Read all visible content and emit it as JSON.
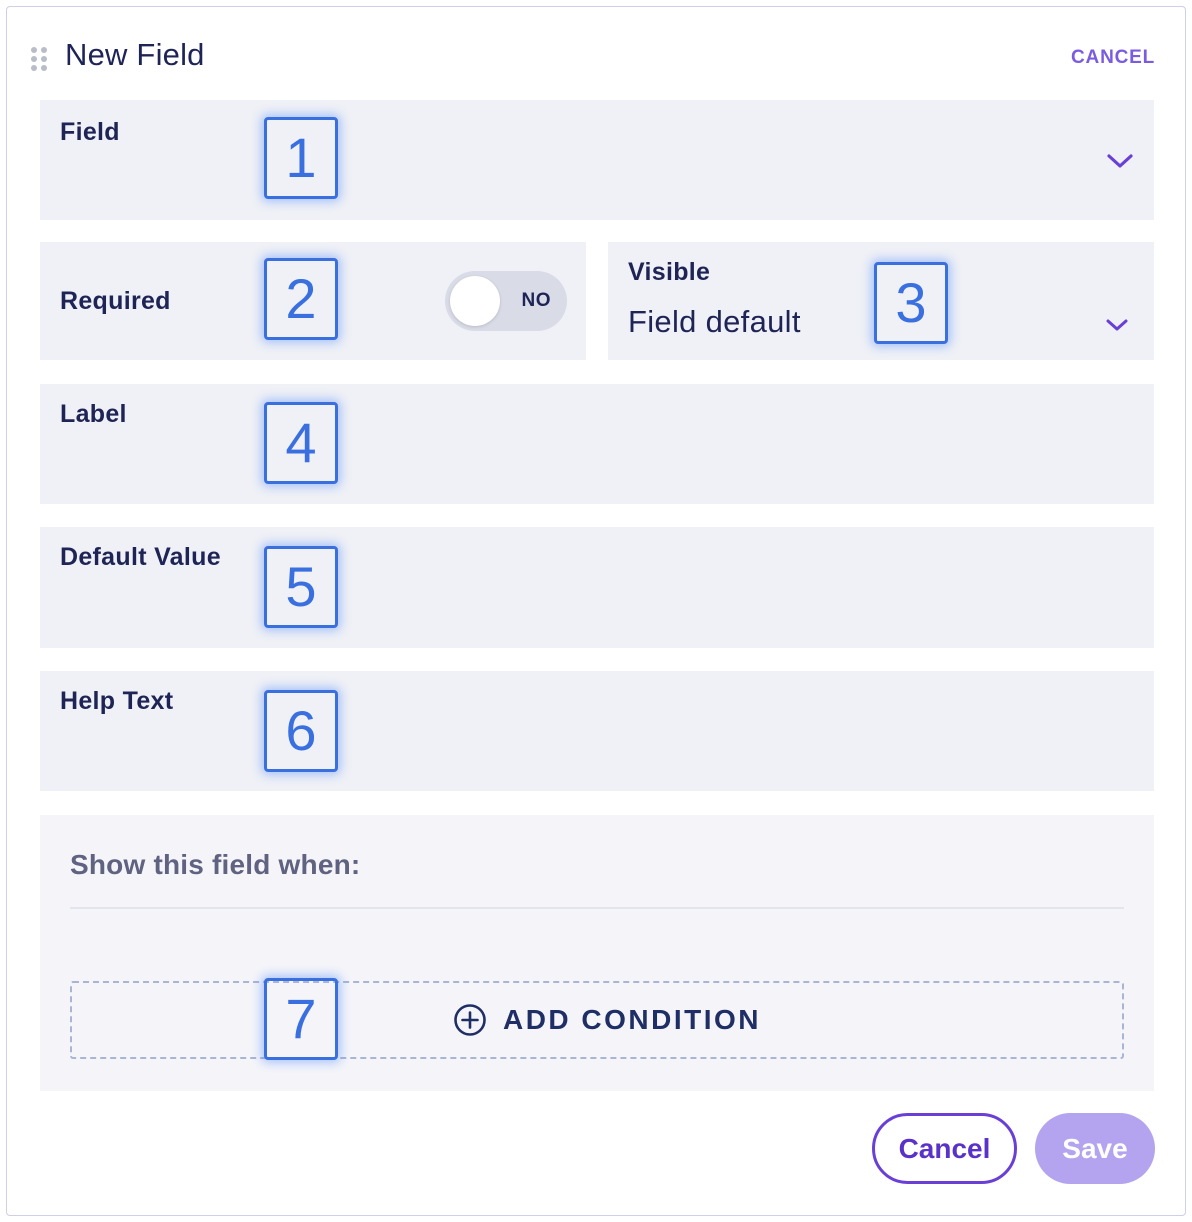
{
  "header": {
    "title": "New Field",
    "cancel_label": "CANCEL",
    "drag_icon": "drag-handle-icon"
  },
  "fields": {
    "field": {
      "label": "Field",
      "value": "",
      "chevron_icon": "chevron-down-icon"
    },
    "required": {
      "label": "Required",
      "toggle_text": "NO",
      "toggle_on": false
    },
    "visible": {
      "label": "Visible",
      "value": "Field default",
      "chevron_icon": "chevron-down-icon"
    },
    "label": {
      "label": "Label",
      "value": ""
    },
    "default_value": {
      "label": "Default Value",
      "value": ""
    },
    "help_text": {
      "label": "Help Text",
      "value": ""
    }
  },
  "conditions": {
    "title": "Show this field when:",
    "add_label": "ADD CONDITION",
    "add_icon": "plus-circle-icon"
  },
  "footer": {
    "cancel_label": "Cancel",
    "save_label": "Save"
  },
  "markers": [
    "1",
    "2",
    "3",
    "4",
    "5",
    "6",
    "7"
  ],
  "colors": {
    "accent": "#6a3fd6",
    "save_disabled": "#b4a3ee",
    "panel_bg": "#f0f1f6",
    "marker": "#3a6fe0",
    "text": "#1f2456"
  }
}
